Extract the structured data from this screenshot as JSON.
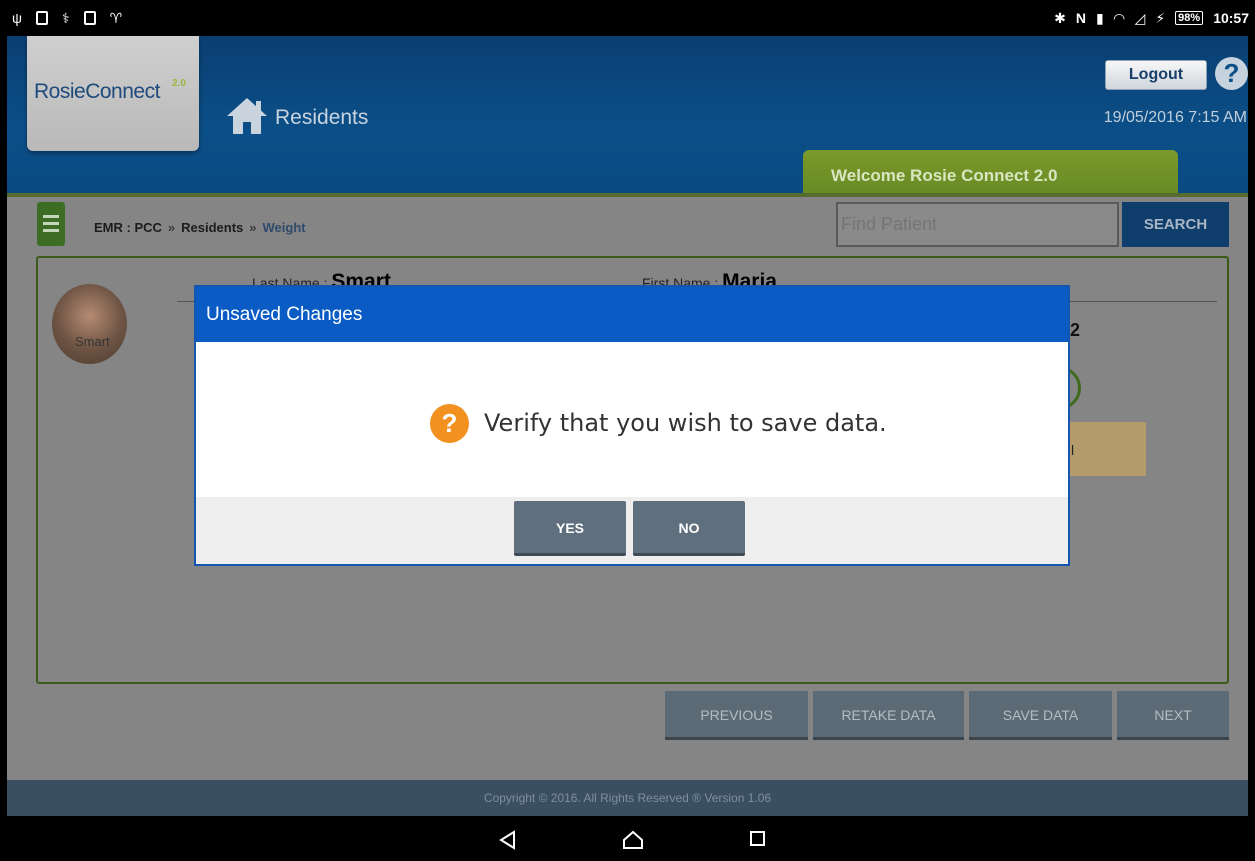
{
  "status_bar": {
    "battery": "98%",
    "time": "10:57"
  },
  "header": {
    "logo_text": "RosieConnect",
    "logo_superscript": "2.0",
    "home_label": "Residents",
    "logout_label": "Logout",
    "help_glyph": "?",
    "datetime": "19/05/2016  7:15 AM",
    "welcome_tab": "Welcome Rosie Connect 2.0"
  },
  "breadcrumb": {
    "items": [
      "EMR : PCC",
      "Residents",
      "Weight"
    ],
    "separator": "»"
  },
  "search": {
    "placeholder": "Find Patient",
    "button_label": "SEARCH"
  },
  "patient": {
    "last_name_label": "Last Name :",
    "last_name": "Smart",
    "first_name_label": "First Name :",
    "first_name": "Maria",
    "avatar_alt": "Smart",
    "partial_value": "2",
    "partial_tan_text": "l"
  },
  "actions": {
    "previous": "PREVIOUS",
    "retake": "RETAKE DATA",
    "save": "SAVE DATA",
    "next": "NEXT"
  },
  "footer": {
    "text": "Copyright © 2016. All Rights Reserved ® Version 1.06"
  },
  "dialog": {
    "title": "Unsaved Changes",
    "icon_glyph": "?",
    "message": "Verify that you wish to save data.",
    "yes_label": "YES",
    "no_label": "NO"
  },
  "colors": {
    "header_blue": "#0b4f88",
    "dialog_blue": "#0a5bc4",
    "accent_green": "#6a8a25",
    "warning_orange": "#f2911f"
  },
  "icons": [
    "home-icon",
    "help-icon",
    "menu-icon",
    "question-icon",
    "back-icon",
    "home-nav-icon",
    "recents-icon"
  ]
}
